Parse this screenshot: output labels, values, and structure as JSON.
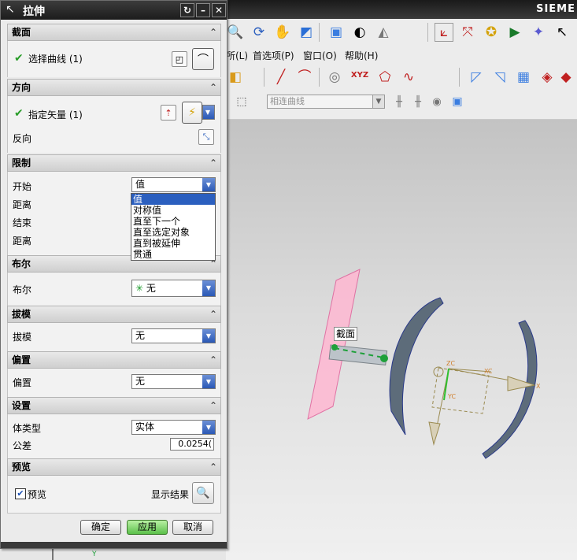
{
  "app": {
    "brand": "SIEME",
    "menu": [
      "所(L)",
      "首选项(P)",
      "窗口(O)",
      "帮助(H)"
    ],
    "snap_combo": "相连曲线",
    "axis_label_y": "Y"
  },
  "viewport": {
    "tooltip": "截面",
    "csys_labels": {
      "zc": "ZC",
      "yc": "YC",
      "xc": "XC",
      "x": "X"
    }
  },
  "dialog": {
    "title": "拉伸",
    "sections": {
      "section": {
        "header": "截面",
        "row_label": "选择曲线 (1)"
      },
      "direction": {
        "header": "方向",
        "vector_label": "指定矢量 (1)",
        "reverse_label": "反向"
      },
      "limits": {
        "header": "限制",
        "start_label": "开始",
        "distance1_label": "距离",
        "end_label": "结束",
        "distance2_label": "距离",
        "start_value": "值",
        "dropdown_options": [
          "值",
          "对称值",
          "直至下一个",
          "直至选定对象",
          "直到被延伸",
          "贯通"
        ],
        "selected_option": "值"
      },
      "boolean": {
        "header": "布尔",
        "label": "布尔",
        "value": "无"
      },
      "draft": {
        "header": "拔模",
        "label": "拔模",
        "value": "无"
      },
      "offset": {
        "header": "偏置",
        "label": "偏置",
        "value": "无"
      },
      "settings": {
        "header": "设置",
        "body_type_label": "体类型",
        "body_type_value": "实体",
        "tolerance_label": "公差",
        "tolerance_value": "0.0254("
      },
      "preview": {
        "header": "预览",
        "preview_label": "预览",
        "show_result_label": "显示结果"
      }
    },
    "buttons": {
      "ok": "确定",
      "apply": "应用",
      "cancel": "取消"
    }
  }
}
